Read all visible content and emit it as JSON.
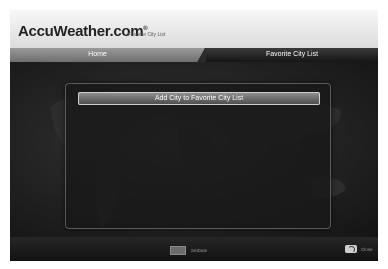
{
  "header": {
    "logo_text": "AccuWeather.com",
    "logo_reg": "®",
    "subtitle": "Favorite City List"
  },
  "tabs": [
    {
      "label": "Home"
    },
    {
      "label": "Favorite City List"
    }
  ],
  "main": {
    "add_button_label": "Add City to Favorite City List"
  },
  "footer": {
    "setdate_label": "SetDate",
    "close_label": "Close"
  },
  "colors": {
    "screen_bg": "#1b1b1b",
    "topbar_bg": "#e8e8e8",
    "button_bg": "#6e6e6e"
  }
}
